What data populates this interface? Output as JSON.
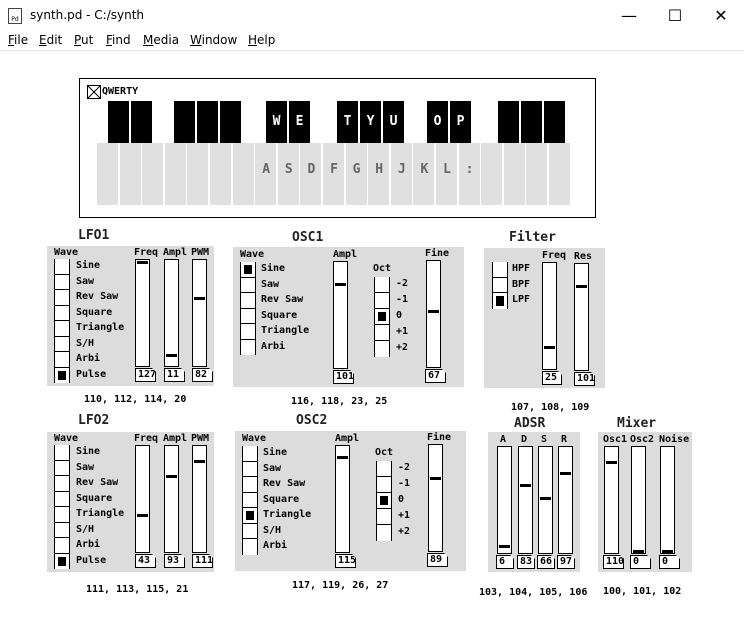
{
  "window": {
    "title": "synth.pd  - C:/synth",
    "icon": "pd-icon",
    "minimize": "—",
    "maximize": "☐",
    "close": "✕"
  },
  "menu": [
    "File",
    "Edit",
    "Put",
    "Find",
    "Media",
    "Window",
    "Help"
  ],
  "keyboard": {
    "label": "QWERTY",
    "toggle_checked": true,
    "black_labels": [
      "W",
      "E",
      "T",
      "Y",
      "U",
      "O",
      "P"
    ],
    "white_labels": [
      "A",
      "S",
      "D",
      "F",
      "G",
      "H",
      "J",
      "K",
      "L",
      ":"
    ]
  },
  "lfo1": {
    "title": "LFO1",
    "wave_label": "Wave",
    "waves": [
      "Sine",
      "Saw",
      "Rev Saw",
      "Square",
      "Triangle",
      "S/H",
      "Arbi",
      "Pulse"
    ],
    "selected": 7,
    "slider_labels": [
      "Freq",
      "Ampl",
      "PWM"
    ],
    "slider_values": [
      "127",
      "11",
      "82"
    ],
    "slider_levels": [
      1.0,
      0.09,
      0.65
    ],
    "numbers": "110, 112, 114, 20"
  },
  "lfo2": {
    "title": "LFO2",
    "wave_label": "Wave",
    "waves": [
      "Sine",
      "Saw",
      "Rev Saw",
      "Square",
      "Triangle",
      "S/H",
      "Arbi",
      "Pulse"
    ],
    "selected": 7,
    "slider_labels": [
      "Freq",
      "Ampl",
      "PWM"
    ],
    "slider_values": [
      "43",
      "93",
      "111"
    ],
    "slider_levels": [
      0.34,
      0.73,
      0.87
    ],
    "numbers": "111, 113, 115, 21"
  },
  "osc1": {
    "title": "OSC1",
    "wave_label": "Wave",
    "waves": [
      "Sine",
      "Saw",
      "Rev Saw",
      "Square",
      "Triangle",
      "Arbi"
    ],
    "selected": 0,
    "ampl_label": "Ampl",
    "ampl_value": "101",
    "ampl_level": 0.8,
    "oct_label": "Oct",
    "oct_options": [
      "-2",
      "-1",
      "0",
      "+1",
      "+2"
    ],
    "oct_selected": 2,
    "fine_label": "Fine",
    "fine_value": "67",
    "fine_level": 0.53,
    "numbers": "116, 118, 23, 25"
  },
  "osc2": {
    "title": "OSC2",
    "wave_label": "Wave",
    "waves": [
      "Sine",
      "Saw",
      "Rev Saw",
      "Square",
      "Triangle",
      "S/H",
      "Arbi"
    ],
    "selected": 4,
    "ampl_label": "Ampl",
    "ampl_value": "115",
    "ampl_level": 0.91,
    "oct_label": "Oct",
    "oct_options": [
      "-2",
      "-1",
      "0",
      "+1",
      "+2"
    ],
    "oct_selected": 2,
    "fine_label": "Fine",
    "fine_value": "89",
    "fine_level": 0.7,
    "numbers": "117, 119, 26, 27"
  },
  "filter": {
    "title": "Filter",
    "types": [
      "HPF",
      "BPF",
      "LPF"
    ],
    "selected": 2,
    "freq_label": "Freq",
    "freq_value": "25",
    "freq_level": 0.2,
    "res_label": "Res",
    "res_value": "101",
    "res_level": 0.8,
    "numbers": "107, 108, 109"
  },
  "adsr": {
    "title": "ADSR",
    "labels": [
      "A",
      "D",
      "S",
      "R"
    ],
    "values": [
      "6",
      "83",
      "66",
      "97"
    ],
    "levels": [
      0.05,
      0.65,
      0.52,
      0.76
    ],
    "numbers": "103, 104, 105, 106"
  },
  "mixer": {
    "title": "Mixer",
    "labels": [
      "Osc1",
      "Osc2",
      "Noise"
    ],
    "values": [
      "110",
      "0",
      "0"
    ],
    "levels": [
      0.87,
      0.0,
      0.0
    ],
    "numbers": "100, 101, 102"
  }
}
